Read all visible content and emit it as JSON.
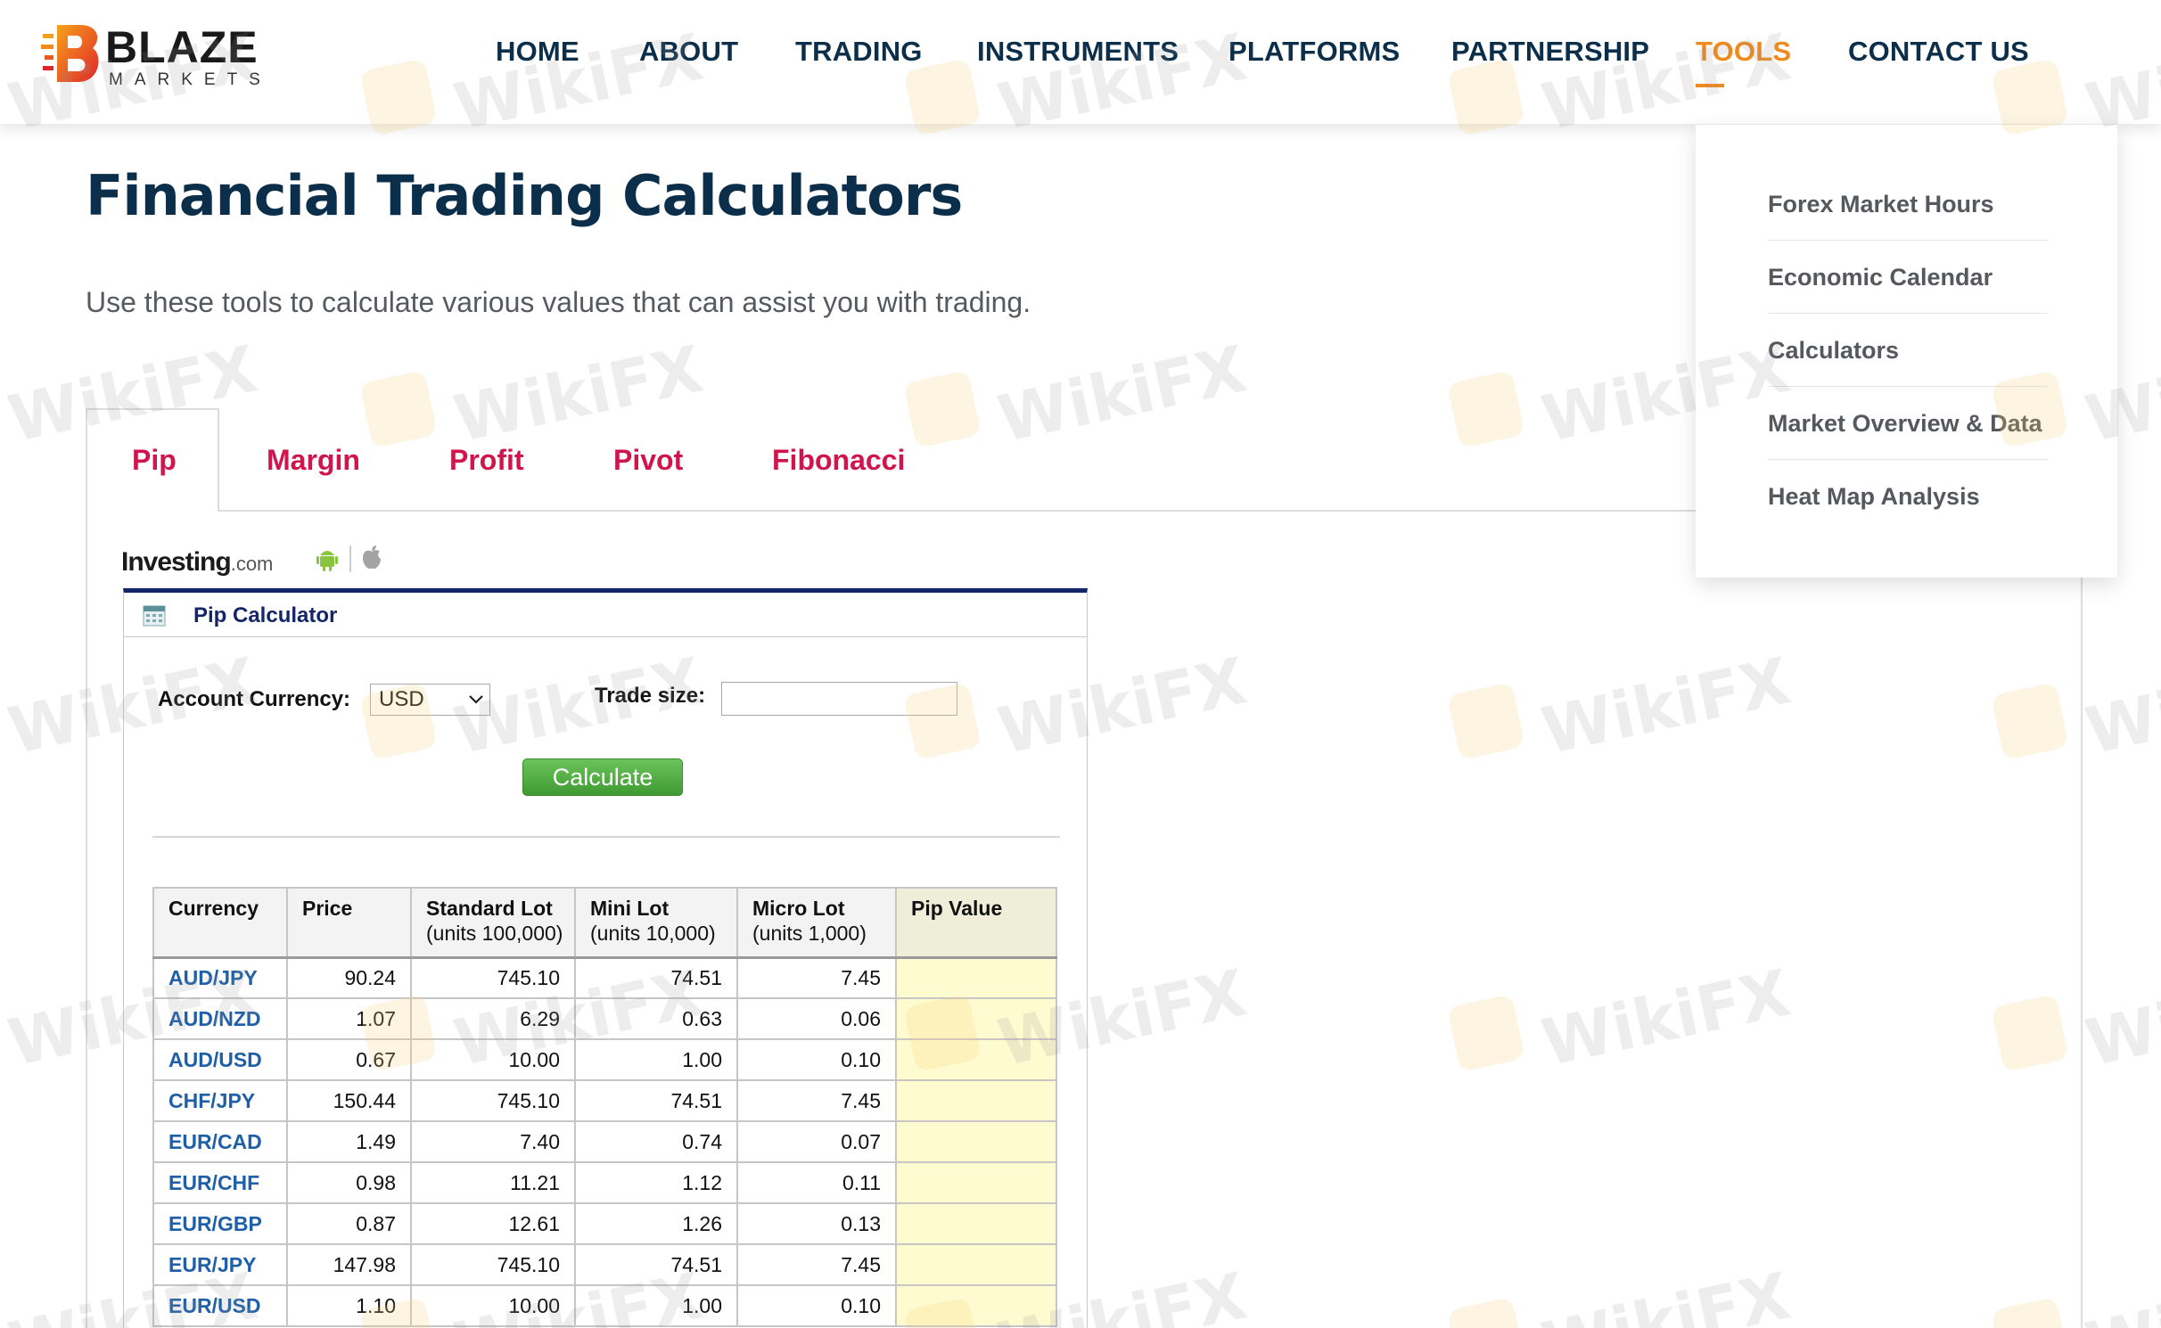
{
  "header": {
    "logo": {
      "wordmark": "BLAZE",
      "subtext": "MARKETS"
    },
    "nav": [
      {
        "label": "HOME"
      },
      {
        "label": "ABOUT"
      },
      {
        "label": "TRADING"
      },
      {
        "label": "INSTRUMENTS"
      },
      {
        "label": "PLATFORMS"
      },
      {
        "label": "PARTNERSHIP"
      },
      {
        "label": "TOOLS",
        "active": true
      },
      {
        "label": "CONTACT US"
      }
    ],
    "accent_color": "#f08a1c"
  },
  "tools_dropdown": {
    "items": [
      {
        "label": "Forex Market Hours"
      },
      {
        "label": "Economic Calendar"
      },
      {
        "label": "Calculators"
      },
      {
        "label": "Market Overview & Data"
      },
      {
        "label": "Heat Map Analysis"
      }
    ]
  },
  "main": {
    "title": "Financial Trading Calculators",
    "subtitle": "Use these tools to calculate various values that can assist you with trading.",
    "tabs": [
      {
        "label": "Pip",
        "active": true
      },
      {
        "label": "Margin"
      },
      {
        "label": "Profit"
      },
      {
        "label": "Pivot"
      },
      {
        "label": "Fibonacci"
      }
    ],
    "tab_color": "#d0154c"
  },
  "widget": {
    "provider_name": "Investing",
    "provider_suffix": ".com",
    "icons": [
      "android-icon",
      "apple-icon",
      "calculator-icon"
    ],
    "title": "Pip Calculator",
    "account_currency_label": "Account Currency:",
    "account_currency_value": "USD",
    "trade_size_label": "Trade size:",
    "trade_size_value": "",
    "calculate_label": "Calculate",
    "table": {
      "headers": [
        {
          "title": "Currency",
          "sub": ""
        },
        {
          "title": "Price",
          "sub": ""
        },
        {
          "title": "Standard Lot",
          "sub": "(units 100,000)"
        },
        {
          "title": "Mini Lot",
          "sub": "(units 10,000)"
        },
        {
          "title": "Micro Lot",
          "sub": "(units 1,000)"
        },
        {
          "title": "Pip Value",
          "sub": ""
        }
      ],
      "rows": [
        [
          "AUD/JPY",
          "90.24",
          "745.10",
          "74.51",
          "7.45",
          ""
        ],
        [
          "AUD/NZD",
          "1.07",
          "6.29",
          "0.63",
          "0.06",
          ""
        ],
        [
          "AUD/USD",
          "0.67",
          "10.00",
          "1.00",
          "0.10",
          ""
        ],
        [
          "CHF/JPY",
          "150.44",
          "745.10",
          "74.51",
          "7.45",
          ""
        ],
        [
          "EUR/CAD",
          "1.49",
          "7.40",
          "0.74",
          "0.07",
          ""
        ],
        [
          "EUR/CHF",
          "0.98",
          "11.21",
          "1.12",
          "0.11",
          ""
        ],
        [
          "EUR/GBP",
          "0.87",
          "12.61",
          "1.26",
          "0.13",
          ""
        ],
        [
          "EUR/JPY",
          "147.98",
          "745.10",
          "74.51",
          "7.45",
          ""
        ],
        [
          "EUR/USD",
          "1.10",
          "10.00",
          "1.00",
          "0.10",
          ""
        ]
      ]
    }
  },
  "watermark": {
    "text": "WikiFX"
  }
}
